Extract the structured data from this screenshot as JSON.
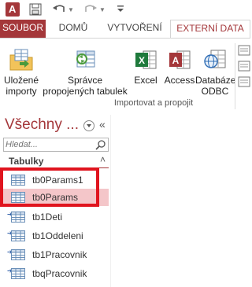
{
  "ribbon_tabs": {
    "file": "SOUBOR",
    "home": "DOMŮ",
    "create": "VYTVOŘENÍ",
    "external": "EXTERNÍ DATA"
  },
  "ribbon": {
    "saved_imports_line1": "Uložené",
    "saved_imports_line2": "importy",
    "linked_table_manager_line1": "Správce",
    "linked_table_manager_line2": "propojených tabulek",
    "excel": "Excel",
    "access": "Access",
    "odbc_line1": "Databáze",
    "odbc_line2": "ODBC",
    "group_label": "Importovat a propojit"
  },
  "nav": {
    "title": "Všechny ...",
    "search_placeholder": "Hledat...",
    "section_label": "Tabulky",
    "items": [
      {
        "label": "tb0Params1",
        "linked": false,
        "selected": false
      },
      {
        "label": "tb0Params",
        "linked": false,
        "selected": true
      },
      {
        "label": "tb1Deti",
        "linked": true,
        "selected": false
      },
      {
        "label": "tb1Oddeleni",
        "linked": true,
        "selected": false
      },
      {
        "label": "tb1Pracovnik",
        "linked": true,
        "selected": false
      },
      {
        "label": "tbqPracovnik",
        "linked": true,
        "selected": false
      }
    ]
  },
  "colors": {
    "accent": "#a4373a",
    "selection": "#f4c6c9",
    "highlight_box": "#e0141e"
  }
}
